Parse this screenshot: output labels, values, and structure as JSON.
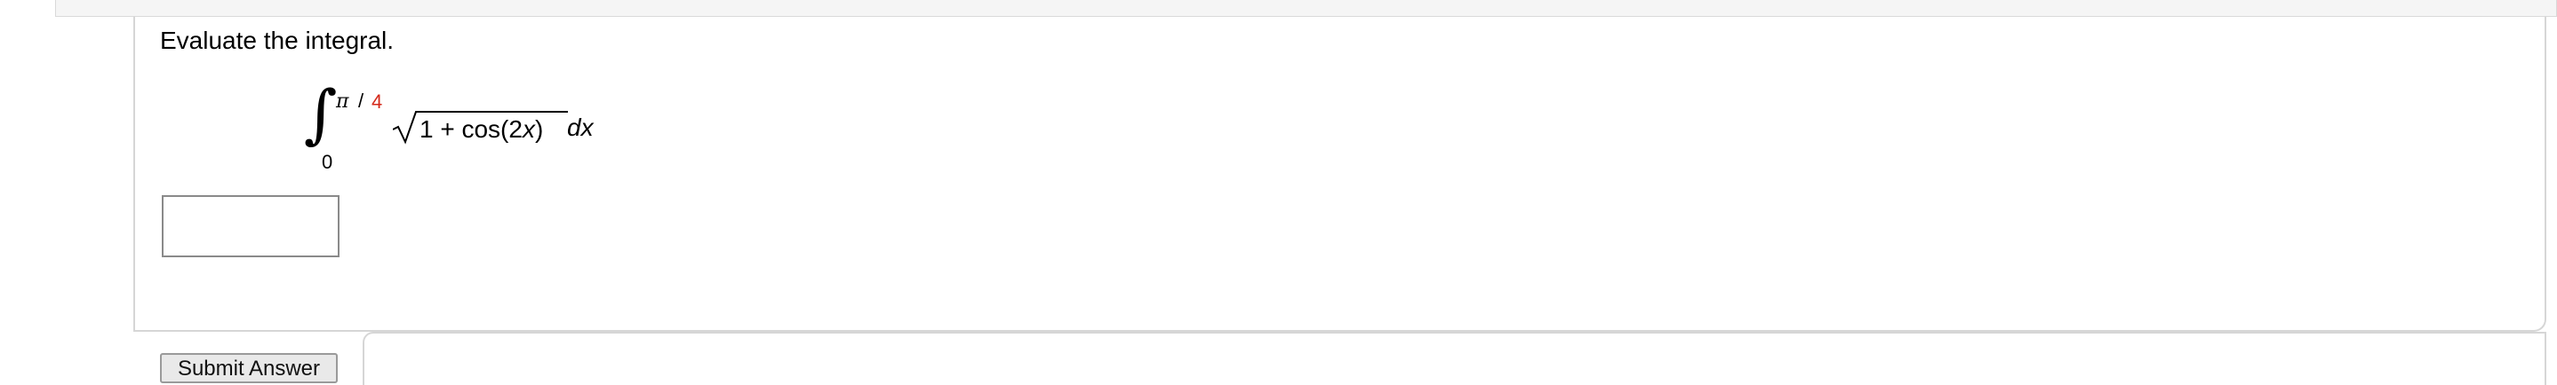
{
  "question": {
    "prompt": "Evaluate the integral.",
    "integral": {
      "upper_limit_pi": "π",
      "upper_limit_slash": "/",
      "upper_limit_denominator": "4",
      "lower_limit": "0",
      "radicand_prefix": "1 + cos(2",
      "radicand_var": "x",
      "radicand_suffix": ")",
      "differential": "dx"
    },
    "answer_value": "",
    "submit_label": "Submit Answer"
  },
  "colors": {
    "limit_highlight": "#d42a1b",
    "panel_border": "#d6d6d6"
  }
}
